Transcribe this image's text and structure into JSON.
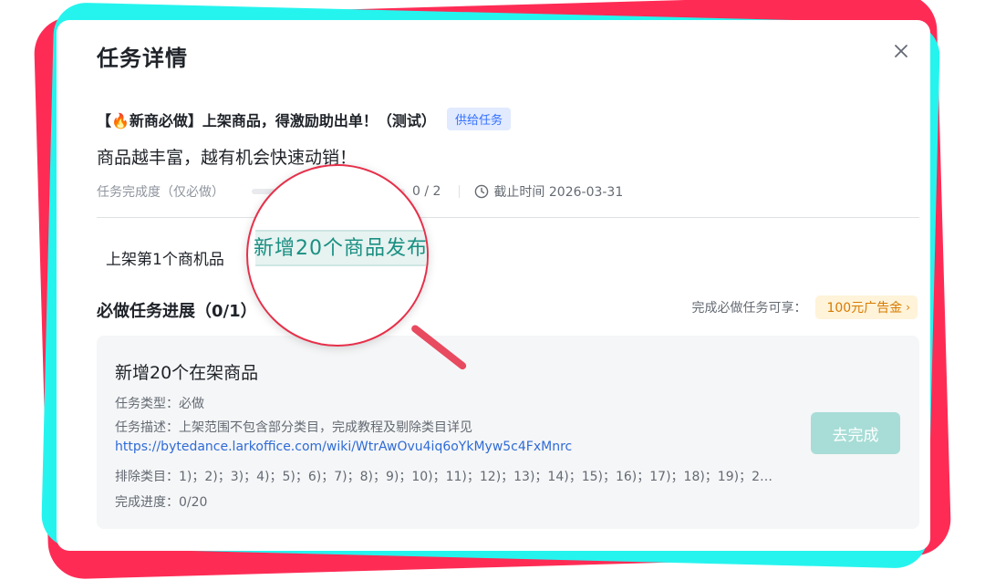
{
  "dialog": {
    "title": "任务详情",
    "close_icon": "close-icon"
  },
  "task": {
    "title": "【🔥新商必做】上架商品，得激励助出单！（测试）",
    "tag": "供给任务",
    "subtitle": "商品越丰富，越有机会快速动销！",
    "progress_label": "任务完成度（仅必做）",
    "progress_count": "0 / 2",
    "progress_fraction": 0.0,
    "deadline": "截止时间 2026-03-31",
    "deadline_icon": "clock-icon"
  },
  "reward_title": "上架第1个商机品",
  "section": {
    "title": "必做任务进展（0/1）",
    "benefit_label": "完成必做任务可享：",
    "coupon": "100元广告金",
    "coupon_icon": "chevron-right-icon"
  },
  "card": {
    "title": "新增20个在架商品",
    "type": "任务类型：必做",
    "desc": "任务描述：上架范围不包含部分类目，完成教程及剔除类目详见",
    "link": "https://bytedance.larkoffice.com/wiki/WtrAwOvu4iq6oYkMyw5c4FxMnrc",
    "excluded": "排除类目：1)；2)；3)；4)；5)；6)；7)；8)；9)；10)；11)；12)；13)；14)；15)；16)；17)；18)；19)；2…",
    "progress": "完成进度：0/20",
    "button": "去完成"
  },
  "magnifier": {
    "text": "新增20个商品发布"
  },
  "colors": {
    "accent_red": "#fe2c55",
    "accent_cyan": "#25f4ee",
    "tag_blue": "#3370ff",
    "button_teal": "#a7ddd6",
    "coupon_orange": "#d67b00"
  }
}
